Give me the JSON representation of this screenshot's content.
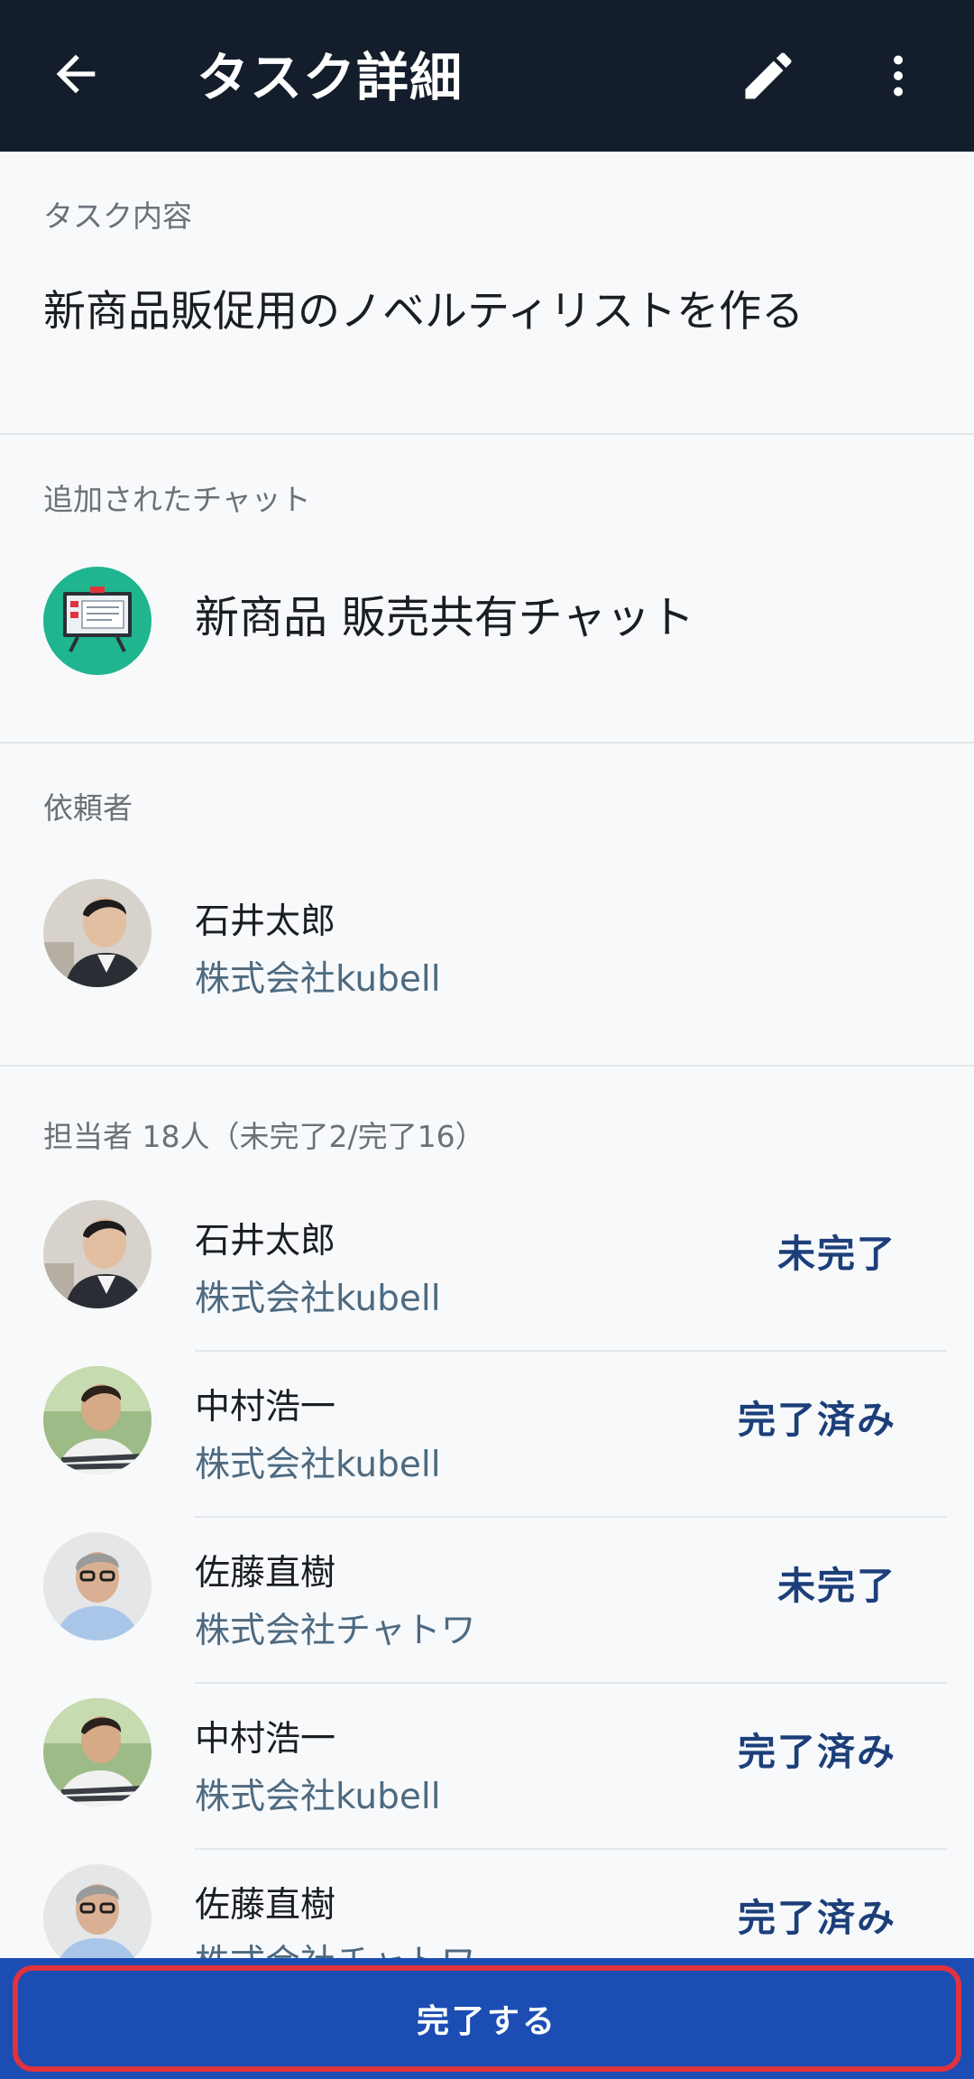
{
  "appbar": {
    "title": "タスク詳細"
  },
  "task": {
    "label": "タスク内容",
    "text": "新商品販促用のノベルティリストを作る"
  },
  "chat": {
    "label": "追加されたチャット",
    "name": "新商品 販売共有チャット"
  },
  "requester": {
    "label": "依頼者",
    "name": "石井太郎",
    "company": "株式会社kubell"
  },
  "assignees": {
    "label": "担当者 18人（未完了2/完了16）",
    "items": [
      {
        "name": "石井太郎",
        "company": "株式会社kubell",
        "status": "未完了"
      },
      {
        "name": "中村浩一",
        "company": "株式会社kubell",
        "status": "完了済み"
      },
      {
        "name": "佐藤直樹",
        "company": "株式会社チャトワ",
        "status": "未完了"
      },
      {
        "name": "中村浩一",
        "company": "株式会社kubell",
        "status": "完了済み"
      },
      {
        "name": "佐藤直樹",
        "company": "株式会社チャトワ",
        "status": "完了済み"
      }
    ]
  },
  "actions": {
    "complete_label": "完了する"
  },
  "colors": {
    "appbar": "#141d2b",
    "accent": "#1b4db3",
    "status": "#1c3f7a",
    "chat_icon": "#1fb58e",
    "highlight": "#e0333f"
  },
  "icons": {
    "back": "arrow-left-icon",
    "edit": "pencil-icon",
    "more": "more-vertical-icon",
    "chat": "presentation-board-icon"
  }
}
